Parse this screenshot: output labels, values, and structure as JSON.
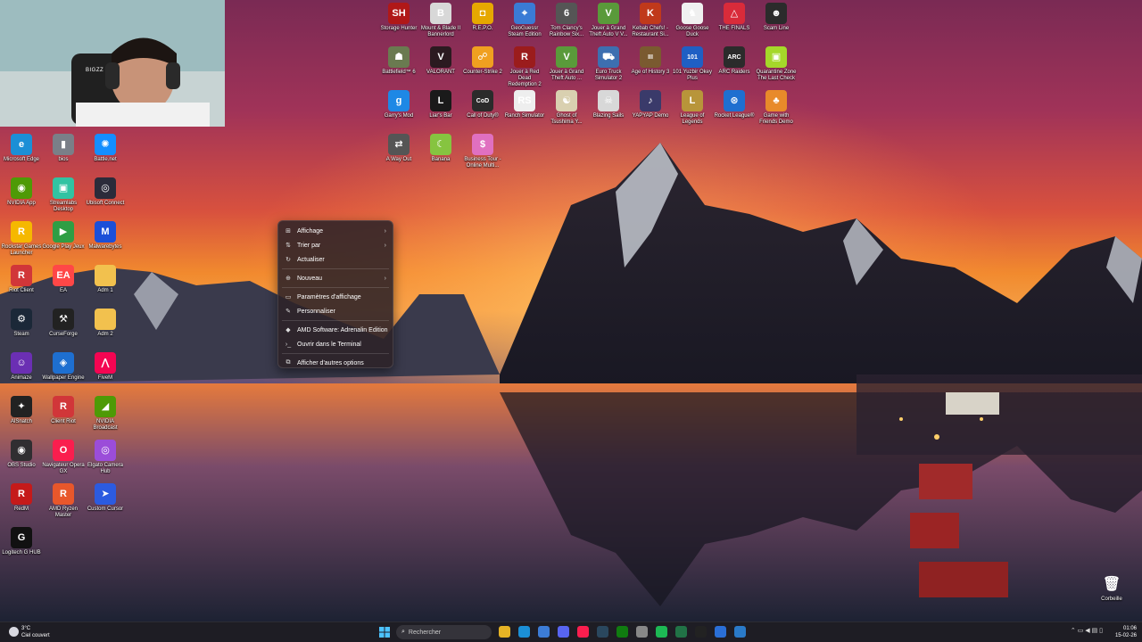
{
  "desktop_icons_left": [
    {
      "label": "Microsoft Edge",
      "icon": "edge-icon",
      "color": "#1b8fd6",
      "glyph": "e"
    },
    {
      "label": "bios",
      "icon": "bios-icon",
      "color": "#7a7f88",
      "glyph": "▮"
    },
    {
      "label": "Battle.net",
      "icon": "battlenet-icon",
      "color": "#148eff",
      "glyph": "✺"
    },
    {
      "label": "NVIDIA App",
      "icon": "nvidia-icon",
      "color": "#4e9a06",
      "glyph": "◉"
    },
    {
      "label": "Streamlabs Desktop",
      "icon": "streamlabs-icon",
      "color": "#31c3a2",
      "glyph": "▣"
    },
    {
      "label": "Ubisoft Connect",
      "icon": "ubisoft-icon",
      "color": "#2b2b3a",
      "glyph": "◎"
    },
    {
      "label": "Rockstar Games Launcher",
      "icon": "rockstar-icon",
      "color": "#f5b800",
      "glyph": "R"
    },
    {
      "label": "Google Play Jeux",
      "icon": "google-play-icon",
      "color": "#2f9e44",
      "glyph": "▶"
    },
    {
      "label": "Malwarebytes",
      "icon": "malwarebytes-icon",
      "color": "#1b4fd8",
      "glyph": "M"
    },
    {
      "label": "Riot Client",
      "icon": "riot-icon",
      "color": "#d13639",
      "glyph": "R"
    },
    {
      "label": "EA",
      "icon": "ea-icon",
      "color": "#ff4747",
      "glyph": "EA"
    },
    {
      "label": "Adm 1",
      "icon": "folder-icon",
      "color": "#f2c14e",
      "glyph": ""
    },
    {
      "label": "Steam",
      "icon": "steam-icon",
      "color": "#1b2838",
      "glyph": "⚙"
    },
    {
      "label": "CurseForge",
      "icon": "curseforge-icon",
      "color": "#222222",
      "glyph": "⚒"
    },
    {
      "label": "Adm 2",
      "icon": "folder-icon",
      "color": "#f2c14e",
      "glyph": ""
    },
    {
      "label": "Animaze",
      "icon": "animaze-icon",
      "color": "#6b2fb3",
      "glyph": "☺"
    },
    {
      "label": "Wallpaper Engine",
      "icon": "wallpaper-engine-icon",
      "color": "#1e6fd0",
      "glyph": "◈"
    },
    {
      "label": "FiveM",
      "icon": "fivem-icon",
      "color": "#f40552",
      "glyph": "⋀"
    },
    {
      "label": "AlSnatch",
      "icon": "alsnatch-icon",
      "color": "#222222",
      "glyph": "✦"
    },
    {
      "label": "Client Riot",
      "icon": "riot-client-icon",
      "color": "#d13639",
      "glyph": "R"
    },
    {
      "label": "NVIDIA Broadcast",
      "icon": "nvidia-broadcast-icon",
      "color": "#4e9a06",
      "glyph": "◢"
    },
    {
      "label": "OBS Studio",
      "icon": "obs-icon",
      "color": "#302e31",
      "glyph": "◉"
    },
    {
      "label": "Navigateur Opera GX",
      "icon": "opera-gx-icon",
      "color": "#fa1e4e",
      "glyph": "O"
    },
    {
      "label": "Elgato Camera Hub",
      "icon": "elgato-icon",
      "color": "#9b4dd9",
      "glyph": "◎"
    },
    {
      "label": "RedM",
      "icon": "redm-icon",
      "color": "#c51a1a",
      "glyph": "R"
    },
    {
      "label": "AMD Ryzen Master",
      "icon": "amd-ryzen-icon",
      "color": "#e8572b",
      "glyph": "R"
    },
    {
      "label": "Custom Cursor",
      "icon": "cursor-icon",
      "color": "#2c5be0",
      "glyph": "➤"
    },
    {
      "label": "Logitech G HUB",
      "icon": "logitech-icon",
      "color": "#111111",
      "glyph": "G"
    }
  ],
  "desktop_icons_top": [
    {
      "label": "Storage Hunter",
      "icon": "storage-hunter-icon",
      "color": "#b01818",
      "glyph": "SH"
    },
    {
      "label": "Mount & Blade II Bannerlord",
      "icon": "bannerlord-icon",
      "color": "#d8d8d8",
      "glyph": "B"
    },
    {
      "label": "R.E.P.O.",
      "icon": "repo-icon",
      "color": "#e6a800",
      "glyph": "◘"
    },
    {
      "label": "GeoGuessr Steam Edition",
      "icon": "geoguessr-icon",
      "color": "#3a7bd5",
      "glyph": "⌖"
    },
    {
      "label": "Tom Clancy's Rainbow Six...",
      "icon": "rainbow-six-icon",
      "color": "#555555",
      "glyph": "6"
    },
    {
      "label": "Jouer à Grand Theft Auto V V...",
      "icon": "gta-v-icon",
      "color": "#5a9a3a",
      "glyph": "V"
    },
    {
      "label": "Kebab Chefs! - Restaurant Si...",
      "icon": "kebab-chefs-icon",
      "color": "#c0391b",
      "glyph": "K"
    },
    {
      "label": "Goose Goose Duck",
      "icon": "goose-icon",
      "color": "#f0f0f0",
      "glyph": "♞"
    },
    {
      "label": "THE FINALS",
      "icon": "the-finals-icon",
      "color": "#d92b3a",
      "glyph": "△"
    },
    {
      "label": "Scam Line",
      "icon": "scam-line-icon",
      "color": "#2b2b2b",
      "glyph": "☻"
    },
    {
      "label": "Battlefield™ 6",
      "icon": "battlefield-icon",
      "color": "#6a7a50",
      "glyph": "☗"
    },
    {
      "label": "VALORANT",
      "icon": "valorant-icon",
      "color": "#2b1a20",
      "glyph": "V"
    },
    {
      "label": "Counter-Strike 2",
      "icon": "cs2-icon",
      "color": "#f0a020",
      "glyph": "☍"
    },
    {
      "label": "Jouer à Red Dead Redemption 2",
      "icon": "rdr2-icon",
      "color": "#9b1c1c",
      "glyph": "R"
    },
    {
      "label": "Jouer à Grand Theft Auto ...",
      "icon": "gta-icon",
      "color": "#5a9a3a",
      "glyph": "V"
    },
    {
      "label": "Euro Truck Simulator 2",
      "icon": "ets2-icon",
      "color": "#3d6fb0",
      "glyph": "⛟"
    },
    {
      "label": "Age of History 3",
      "icon": "age-of-history-icon",
      "color": "#7a5a30",
      "glyph": "III"
    },
    {
      "label": "101 Yuzbir Okey Plus",
      "icon": "okey-icon",
      "color": "#1f5fc4",
      "glyph": "101"
    },
    {
      "label": "ARC Raiders",
      "icon": "arc-raiders-icon",
      "color": "#2b2b2b",
      "glyph": "ARC"
    },
    {
      "label": "Quarantine Zone The Last Check",
      "icon": "quarantine-zone-icon",
      "color": "#a5d82a",
      "glyph": "▣"
    },
    {
      "label": "Garry's Mod",
      "icon": "garrys-mod-icon",
      "color": "#1e88e5",
      "glyph": "g"
    },
    {
      "label": "Liar's Bar",
      "icon": "liars-bar-icon",
      "color": "#1a1a1a",
      "glyph": "L"
    },
    {
      "label": "Call of Duty®",
      "icon": "call-of-duty-icon",
      "color": "#2b2b2b",
      "glyph": "CoD"
    },
    {
      "label": "Ranch Simulator",
      "icon": "ranch-simulator-icon",
      "color": "#eeeeee",
      "glyph": "RS"
    },
    {
      "label": "Ghost of Tsushima Y...",
      "icon": "ghost-tsushima-icon",
      "color": "#d9d0b0",
      "glyph": "☯"
    },
    {
      "label": "Blazing Sails",
      "icon": "blazing-sails-icon",
      "color": "#d8d8d8",
      "glyph": "☠"
    },
    {
      "label": "YAPYAP Demo",
      "icon": "yapyap-icon",
      "color": "#3a3a6a",
      "glyph": "♪"
    },
    {
      "label": "League of Legends",
      "icon": "league-icon",
      "color": "#b8953a",
      "glyph": "L"
    },
    {
      "label": "Rocket League®",
      "icon": "rocket-league-icon",
      "color": "#1f6fd0",
      "glyph": "⊛"
    },
    {
      "label": "Game with Friends Demo",
      "icon": "game-friends-icon",
      "color": "#e88a2a",
      "glyph": "♣"
    },
    {
      "label": "A Way Out",
      "icon": "a-way-out-icon",
      "color": "#555555",
      "glyph": "⇄"
    },
    {
      "label": "Banana",
      "icon": "banana-icon",
      "color": "#86c440",
      "glyph": "☾"
    },
    {
      "label": "Business Tour - Online Multi...",
      "icon": "business-tour-icon",
      "color": "#e070c0",
      "glyph": "$"
    }
  ],
  "context_menu": {
    "items": [
      {
        "label": "Affichage",
        "icon": "grid-icon",
        "glyph": "⊞",
        "submenu": true
      },
      {
        "label": "Trier par",
        "icon": "sort-icon",
        "glyph": "⇅",
        "submenu": true
      },
      {
        "label": "Actualiser",
        "icon": "refresh-icon",
        "glyph": "↻",
        "submenu": false
      },
      {
        "sep": true
      },
      {
        "label": "Nouveau",
        "icon": "new-icon",
        "glyph": "⊕",
        "submenu": true
      },
      {
        "sep": true
      },
      {
        "label": "Paramètres d'affichage",
        "icon": "display-icon",
        "glyph": "▭",
        "submenu": false
      },
      {
        "label": "Personnaliser",
        "icon": "brush-icon",
        "glyph": "✎",
        "submenu": false
      },
      {
        "sep": true
      },
      {
        "label": "AMD Software: Adrenalin Edition",
        "icon": "amd-icon",
        "glyph": "◆",
        "submenu": false
      },
      {
        "label": "Ouvrir dans le Terminal",
        "icon": "terminal-icon",
        "glyph": "›_",
        "submenu": false
      },
      {
        "sep": true
      },
      {
        "label": "Afficher d'autres options",
        "icon": "more-options-icon",
        "glyph": "⧉",
        "submenu": false
      }
    ]
  },
  "recycle_bin": {
    "label": "Corbeille"
  },
  "webcam": {
    "overlay_text": "BIGZZ"
  },
  "taskbar": {
    "weather": {
      "temp": "3°C",
      "desc": "Ciel couvert"
    },
    "search_placeholder": "Rechercher",
    "apps": [
      {
        "icon": "file-explorer-icon",
        "color": "#e6b325"
      },
      {
        "icon": "edge-taskbar-icon",
        "color": "#1b8fd6"
      },
      {
        "icon": "store-icon",
        "color": "#3c7cd6"
      },
      {
        "icon": "discord-icon",
        "color": "#5865f2"
      },
      {
        "icon": "opera-gx-taskbar-icon",
        "color": "#fa1e4e"
      },
      {
        "icon": "steam-taskbar-icon",
        "color": "#2a475e"
      },
      {
        "icon": "xbox-icon",
        "color": "#107c10"
      },
      {
        "icon": "settings-icon",
        "color": "#888888"
      },
      {
        "icon": "spotify-icon",
        "color": "#1db954"
      },
      {
        "icon": "excel-icon",
        "color": "#217346"
      },
      {
        "icon": "capcut-icon",
        "color": "#222222"
      },
      {
        "icon": "notes-icon",
        "color": "#2a6fd6"
      },
      {
        "icon": "vscode-icon",
        "color": "#2a7ac8"
      }
    ],
    "clock": {
      "time": "01:06",
      "date": "15-02-26"
    }
  }
}
